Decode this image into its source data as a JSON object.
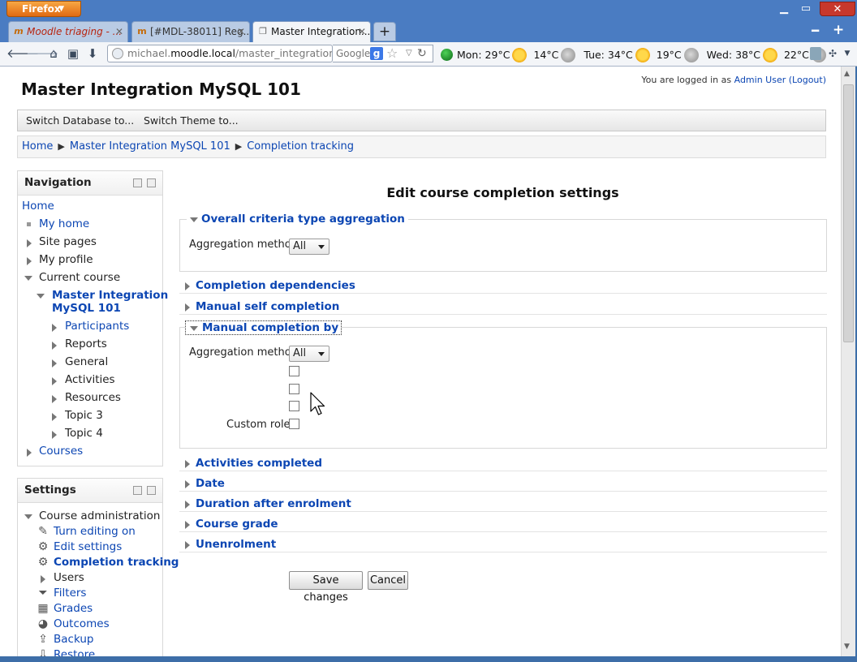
{
  "browser": {
    "app_button": "Firefox",
    "tabs": [
      {
        "label": "Moodle triaging - ...",
        "icon": "moodle-icon"
      },
      {
        "label": "[#MDL-38011] Reg...",
        "icon": "moodle-icon"
      },
      {
        "label": "Master Integration...",
        "icon": "page-icon"
      }
    ],
    "url_prefix": "michael.",
    "url_host": "moodle.local",
    "url_path": "/master_integration/cours",
    "search_placeholder": "Google",
    "weather": {
      "mon": "Mon: 29°C",
      "mon_low": "14°C",
      "tue": "Tue: 34°C",
      "tue_low": "19°C",
      "wed": "Wed: 38°C",
      "wed_low": "22°C"
    }
  },
  "site": {
    "title": "Master Integration MySQL 101",
    "login_prefix": "You are logged in as ",
    "login_user": "Admin User",
    "logout_label": "(Logout)"
  },
  "custom_menu": {
    "db": "Switch Database to...",
    "theme": "Switch Theme to..."
  },
  "breadcrumb": [
    "Home",
    "Master Integration MySQL 101",
    "Completion tracking"
  ],
  "navigation": {
    "title": "Navigation",
    "home": "Home",
    "my_home": "My home",
    "site_pages": "Site pages",
    "my_profile": "My profile",
    "current_course": "Current course",
    "course_line1": "Master Integration",
    "course_line2": "MySQL 101",
    "participants": "Participants",
    "reports": "Reports",
    "general": "General",
    "activities": "Activities",
    "resources": "Resources",
    "topic3": "Topic 3",
    "topic4": "Topic 4",
    "courses": "Courses"
  },
  "settings": {
    "title": "Settings",
    "course_admin": "Course administration",
    "turn_editing_on": "Turn editing on",
    "edit_settings": "Edit settings",
    "completion_tracking": "Completion tracking",
    "users": "Users",
    "filters": "Filters",
    "grades": "Grades",
    "outcomes": "Outcomes",
    "backup": "Backup",
    "restore": "Restore"
  },
  "form": {
    "heading": "Edit course completion settings",
    "overall_legend": "Overall criteria type aggregation",
    "aggregation_label": "Aggregation method",
    "aggregation_value": "All",
    "completion_dependencies": "Completion dependencies",
    "manual_self": "Manual self completion",
    "manual_by": "Manual completion by",
    "manual_aggregation_value": "All",
    "custom_role": "Custom role",
    "activities_completed": "Activities completed",
    "date": "Date",
    "duration_after_enrolment": "Duration after enrolment",
    "course_grade": "Course grade",
    "unenrolment": "Unenrolment",
    "save": "Save changes",
    "cancel": "Cancel"
  }
}
